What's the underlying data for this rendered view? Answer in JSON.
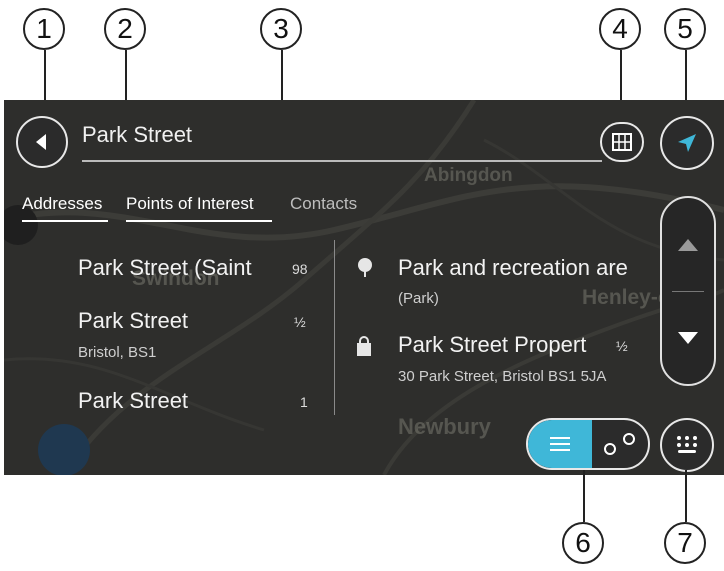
{
  "callouts": [
    "1",
    "2",
    "3",
    "4",
    "5",
    "6",
    "7"
  ],
  "search": {
    "query": "Park Street"
  },
  "tabs": [
    {
      "label": "Addresses",
      "active": true
    },
    {
      "label": "Points of Interest",
      "active": true
    },
    {
      "label": "Contacts",
      "active": false
    }
  ],
  "map_labels": [
    "Abingdon",
    "Swindon",
    "Henley-on-T",
    "Newbury"
  ],
  "results_left": [
    {
      "title": "Park Street (Saint",
      "distance": "98",
      "subtitle": ""
    },
    {
      "title": "Park Street",
      "distance": "½",
      "subtitle": "Bristol, BS1"
    },
    {
      "title": "Park Street",
      "distance": "1",
      "subtitle": ""
    }
  ],
  "results_right": [
    {
      "title": "Park and recreation are",
      "distance": "",
      "subtitle": "(Park)",
      "icon": "tree-icon"
    },
    {
      "title": "Park Street Propert",
      "distance": "½",
      "subtitle": "30 Park Street, Bristol BS1 5JA",
      "icon": "shopping-bag-icon"
    }
  ],
  "colors": {
    "accent": "#3fb7d8",
    "background": "#2c2c2a"
  },
  "icons": [
    "back-arrow-icon",
    "map-grid-icon",
    "navigation-arrow-icon",
    "chevron-up-icon",
    "chevron-down-icon",
    "list-icon",
    "route-icon",
    "keyboard-icon",
    "tree-icon",
    "shopping-bag-icon"
  ]
}
